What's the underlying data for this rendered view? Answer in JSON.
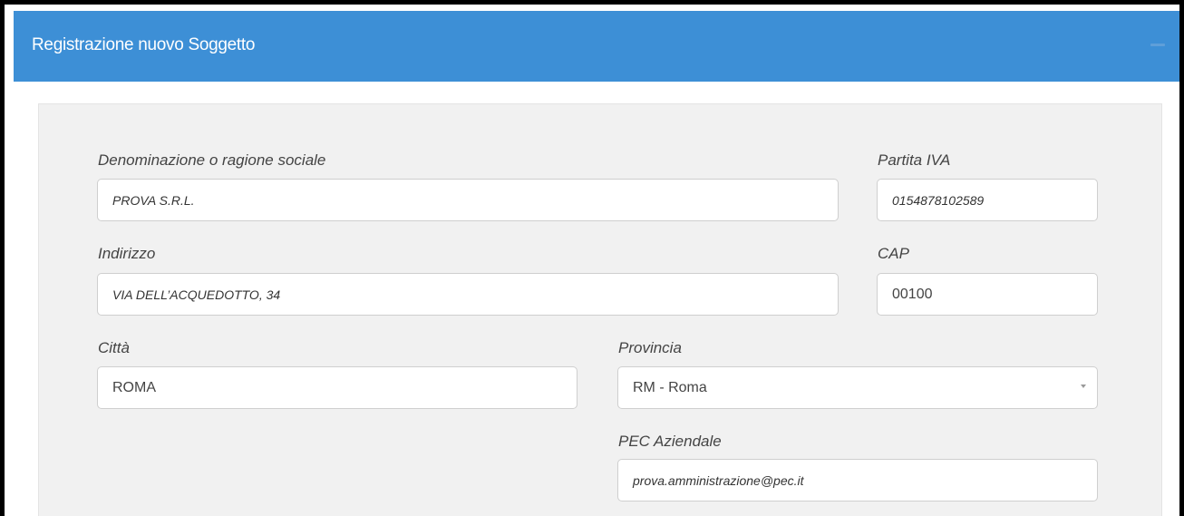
{
  "header": {
    "title": "Registrazione nuovo Soggetto"
  },
  "form": {
    "denominazione": {
      "label": "Denominazione o ragione sociale",
      "value": "PROVA S.R.L."
    },
    "partita_iva": {
      "label": "Partita IVA",
      "value": "0154878102589"
    },
    "indirizzo": {
      "label": "Indirizzo",
      "value": "VIA DELL’ACQUEDOTTO, 34"
    },
    "cap": {
      "label": "CAP",
      "value": "00100"
    },
    "citta": {
      "label": "Città",
      "value": "ROMA"
    },
    "provincia": {
      "label": "Provincia",
      "value": "RM - Roma"
    },
    "pec": {
      "label": "PEC Aziendale",
      "value": "prova.amministrazione@pec.it"
    }
  },
  "colors": {
    "header_bg": "#3d8fd6",
    "panel_bg": "#f1f1f1",
    "input_border": "#cfcfcf"
  }
}
